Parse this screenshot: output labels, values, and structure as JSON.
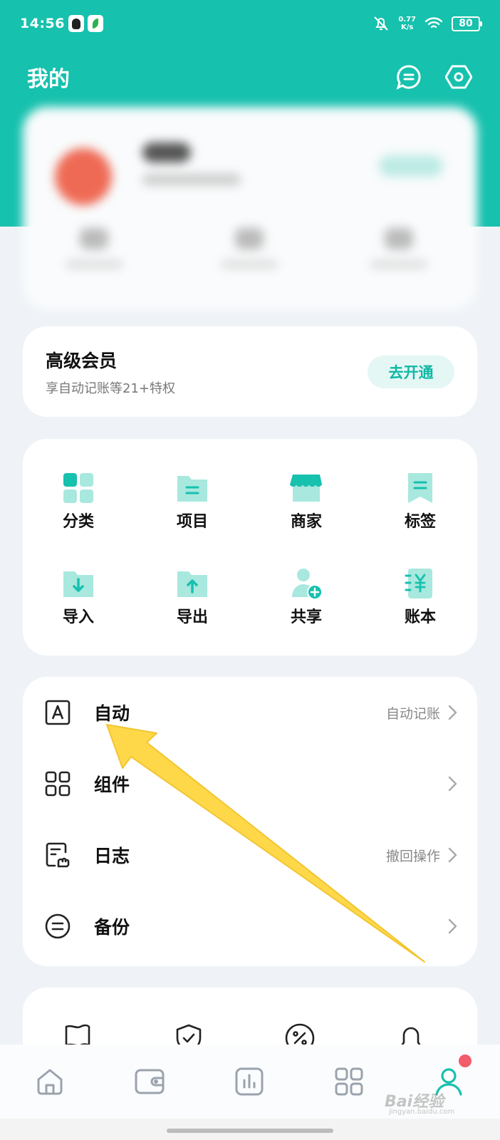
{
  "status_bar": {
    "time": "14:56",
    "net_speed_value": "0.77",
    "net_speed_unit": "K/s",
    "battery": "80"
  },
  "header": {
    "title": "我的",
    "message_icon": "message-icon",
    "settings_icon": "gear-icon"
  },
  "premium": {
    "title": "高级会员",
    "subtitle": "享自动记账等21+特权",
    "button": "去开通"
  },
  "grid": {
    "items": [
      {
        "label": "分类",
        "icon": "category-icon"
      },
      {
        "label": "项目",
        "icon": "project-icon"
      },
      {
        "label": "商家",
        "icon": "merchant-icon"
      },
      {
        "label": "标签",
        "icon": "tag-icon"
      },
      {
        "label": "导入",
        "icon": "import-icon"
      },
      {
        "label": "导出",
        "icon": "export-icon"
      },
      {
        "label": "共享",
        "icon": "share-icon"
      },
      {
        "label": "账本",
        "icon": "ledger-icon"
      }
    ]
  },
  "list": {
    "items": [
      {
        "label": "自动",
        "hint": "自动记账",
        "icon": "auto-icon"
      },
      {
        "label": "组件",
        "hint": "",
        "icon": "widget-icon"
      },
      {
        "label": "日志",
        "hint": "撤回操作",
        "icon": "log-icon"
      },
      {
        "label": "备份",
        "hint": "",
        "icon": "backup-icon"
      }
    ]
  },
  "tabs": [
    {
      "icon": "home-icon"
    },
    {
      "icon": "wallet-icon"
    },
    {
      "icon": "chart-icon"
    },
    {
      "icon": "apps-icon"
    },
    {
      "icon": "profile-icon",
      "active": true,
      "badge": true
    }
  ],
  "colors": {
    "accent": "#16c1ae",
    "accent_light": "#a8e8de",
    "arrow": "#ffd84a",
    "badge": "#f25c6b"
  },
  "watermark": {
    "text": "Bai经验",
    "sub": "jingyan.baidu.com"
  }
}
